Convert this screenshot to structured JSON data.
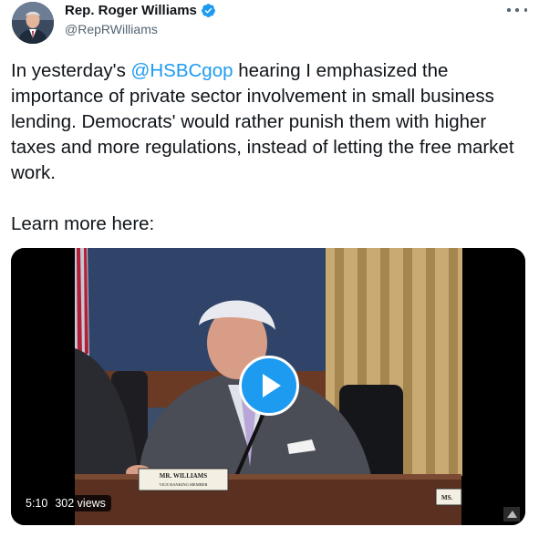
{
  "author": {
    "name": "Rep. Roger Williams",
    "handle": "@RepRWilliams",
    "verified": true
  },
  "tweet": {
    "text_before_mention": "In yesterday's ",
    "mention": "@HSBCgop",
    "text_after_mention": " hearing I emphasized the importance of private sector involvement in small business lending. Democrats' would rather punish them with higher taxes and more regulations, instead of letting the free market work.",
    "learn_more": "Learn more here:"
  },
  "video": {
    "duration": "5:10",
    "views": "302 views",
    "nameplate_name": "MR. WILLIAMS",
    "nameplate_title": "VICE RANKING MEMBER",
    "nameplate_right": "MS."
  },
  "colors": {
    "accent": "#1d9bf0",
    "text": "#0f1419",
    "secondary": "#536471"
  },
  "icons": {
    "verified": "verified-badge-icon",
    "more": "more-options-icon",
    "play": "play-icon"
  }
}
